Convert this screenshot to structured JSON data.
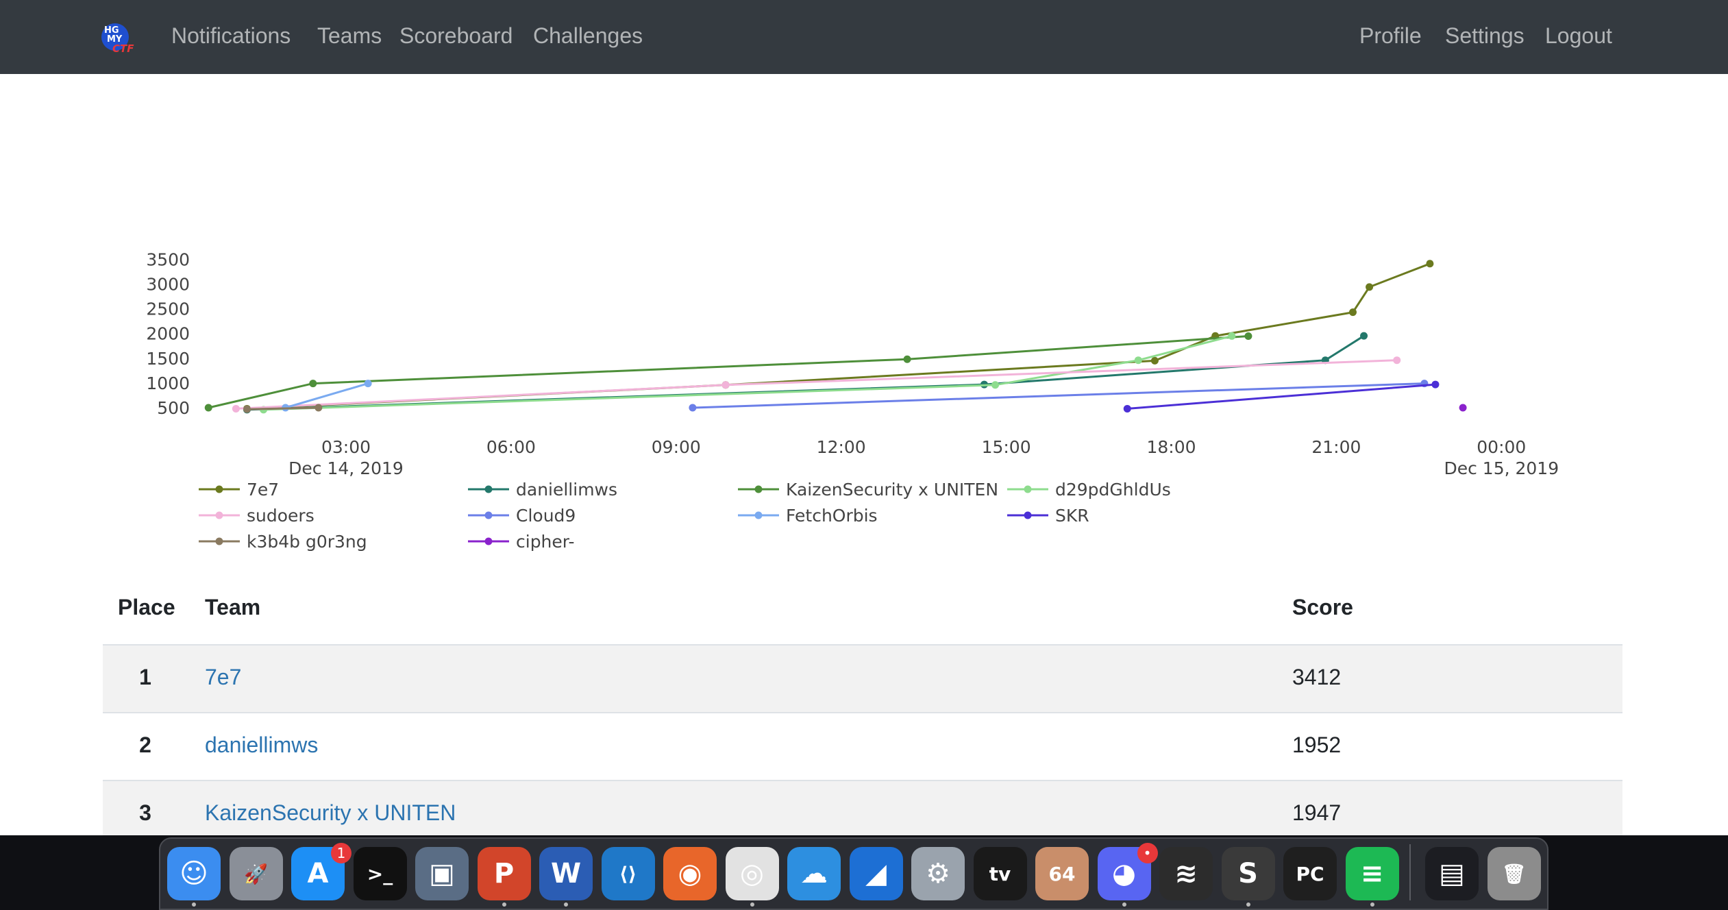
{
  "navbar": {
    "brand_colors": {
      "primary": "#1f4fcf",
      "accent": "#e8383a",
      "text": "#ffffff"
    },
    "left_links": [
      "Notifications",
      "Teams",
      "Scoreboard",
      "Challenges"
    ],
    "right_links": [
      "Profile",
      "Settings",
      "Logout"
    ]
  },
  "chart_data": {
    "type": "line",
    "ylim": [
      500,
      3500
    ],
    "yticks": [
      500,
      1000,
      1500,
      2000,
      2500,
      3000,
      3500
    ],
    "xticks": [
      {
        "label": "03:00",
        "sublabel": "Dec 14, 2019"
      },
      {
        "label": "06:00",
        "sublabel": ""
      },
      {
        "label": "09:00",
        "sublabel": ""
      },
      {
        "label": "12:00",
        "sublabel": ""
      },
      {
        "label": "15:00",
        "sublabel": ""
      },
      {
        "label": "18:00",
        "sublabel": ""
      },
      {
        "label": "21:00",
        "sublabel": ""
      },
      {
        "label": "00:00",
        "sublabel": "Dec 15, 2019"
      }
    ],
    "x_unit": "hours",
    "legend_placement": "bottom",
    "series": [
      {
        "name": "7e7",
        "color": "#6b7a1f",
        "points": [
          [
            1.2,
            480
          ],
          [
            9.9,
            960
          ],
          [
            17.7,
            1450
          ],
          [
            18.8,
            1950
          ],
          [
            21.3,
            2430
          ],
          [
            21.6,
            2940
          ],
          [
            22.7,
            3412
          ]
        ]
      },
      {
        "name": "daniellimws",
        "color": "#23786b",
        "points": [
          [
            1.2,
            460
          ],
          [
            14.6,
            970
          ],
          [
            20.8,
            1460
          ],
          [
            21.5,
            1952
          ]
        ]
      },
      {
        "name": "KaizenSecurity x UNITEN",
        "color": "#4e8f3a",
        "points": [
          [
            0.5,
            500
          ],
          [
            2.4,
            990
          ],
          [
            13.2,
            1480
          ],
          [
            19.4,
            1947
          ]
        ]
      },
      {
        "name": "d29pdGhldUs",
        "color": "#8edc8e",
        "points": [
          [
            1.5,
            460
          ],
          [
            14.8,
            960
          ],
          [
            17.4,
            1460
          ],
          [
            19.1,
            1950
          ]
        ]
      },
      {
        "name": "sudoers",
        "color": "#f2b3d9",
        "points": [
          [
            1.0,
            480
          ],
          [
            9.9,
            960
          ],
          [
            22.1,
            1460
          ]
        ]
      },
      {
        "name": "Cloud9",
        "color": "#6b7fe8",
        "points": [
          [
            9.3,
            500
          ],
          [
            22.6,
            990
          ]
        ]
      },
      {
        "name": "FetchOrbis",
        "color": "#7aaaf0",
        "points": [
          [
            1.9,
            500
          ],
          [
            3.4,
            990
          ]
        ]
      },
      {
        "name": "SKR",
        "color": "#4b2fd6",
        "points": [
          [
            17.2,
            480
          ],
          [
            22.8,
            970
          ]
        ]
      },
      {
        "name": "k3b4b g0r3ng",
        "color": "#8a7a60",
        "points": [
          [
            1.2,
            470
          ],
          [
            2.5,
            500
          ]
        ]
      },
      {
        "name": "cipher-",
        "color": "#8a22cc",
        "points": [
          [
            23.3,
            500
          ]
        ]
      }
    ]
  },
  "table": {
    "headers": {
      "place": "Place",
      "team": "Team",
      "score": "Score"
    },
    "rows": [
      {
        "place": "1",
        "team": "7e7",
        "score": "3412"
      },
      {
        "place": "2",
        "team": "daniellimws",
        "score": "1952"
      },
      {
        "place": "3",
        "team": "KaizenSecurity x UNITEN",
        "score": "1947"
      }
    ]
  },
  "dock": {
    "apps": [
      {
        "name": "finder-icon",
        "glyph": "☺",
        "bg": "#3b8df0",
        "running": true
      },
      {
        "name": "launchpad-icon",
        "glyph": "🚀",
        "bg": "#8a8f98",
        "running": false
      },
      {
        "name": "app-store-icon",
        "glyph": "A",
        "bg": "#1d8ff5",
        "running": false,
        "badge": "1"
      },
      {
        "name": "terminal-icon",
        "glyph": ">_",
        "bg": "#111111",
        "running": false
      },
      {
        "name": "virtualbox-icon",
        "glyph": "▣",
        "bg": "#5a6d85",
        "running": false
      },
      {
        "name": "powerpoint-icon",
        "glyph": "P",
        "bg": "#d2452a",
        "running": true
      },
      {
        "name": "word-icon",
        "glyph": "W",
        "bg": "#2b5db4",
        "running": true
      },
      {
        "name": "vscode-icon",
        "glyph": "⟨⟩",
        "bg": "#1f78c8",
        "running": false
      },
      {
        "name": "firefox-icon",
        "glyph": "◉",
        "bg": "#e8662a",
        "running": false
      },
      {
        "name": "chrome-icon",
        "glyph": "◎",
        "bg": "#e2e2e2",
        "running": true
      },
      {
        "name": "cloud-app-icon",
        "glyph": "☁",
        "bg": "#2d8fe0",
        "running": false
      },
      {
        "name": "wireshark-icon",
        "glyph": "◢",
        "bg": "#1d6fd4",
        "running": false
      },
      {
        "name": "system-preferences-icon",
        "glyph": "⚙",
        "bg": "#9aa3ad",
        "running": false
      },
      {
        "name": "apple-tv-icon",
        "glyph": "tv",
        "bg": "#1a1a1a",
        "running": false
      },
      {
        "name": "portrait-app-icon",
        "glyph": "64",
        "bg": "#c98e6a",
        "running": false
      },
      {
        "name": "discord-icon",
        "glyph": "◕",
        "bg": "#5865f2",
        "running": true,
        "badge": "•"
      },
      {
        "name": "stacked-layers-icon",
        "glyph": "≋",
        "bg": "#2c2c2c",
        "running": false
      },
      {
        "name": "sublime-text-icon",
        "glyph": "S",
        "bg": "#3a3a3a",
        "running": true
      },
      {
        "name": "pycharm-icon",
        "glyph": "PC",
        "bg": "#1f1f1f",
        "running": false
      },
      {
        "name": "spotify-icon",
        "glyph": "≡",
        "bg": "#1db954",
        "running": true
      },
      {
        "name": "recent-window-icon",
        "glyph": "▤",
        "bg": "#1c1d22",
        "running": false
      },
      {
        "name": "trash-icon",
        "glyph": "🗑",
        "bg": "#8c8c8c",
        "running": false
      }
    ]
  }
}
